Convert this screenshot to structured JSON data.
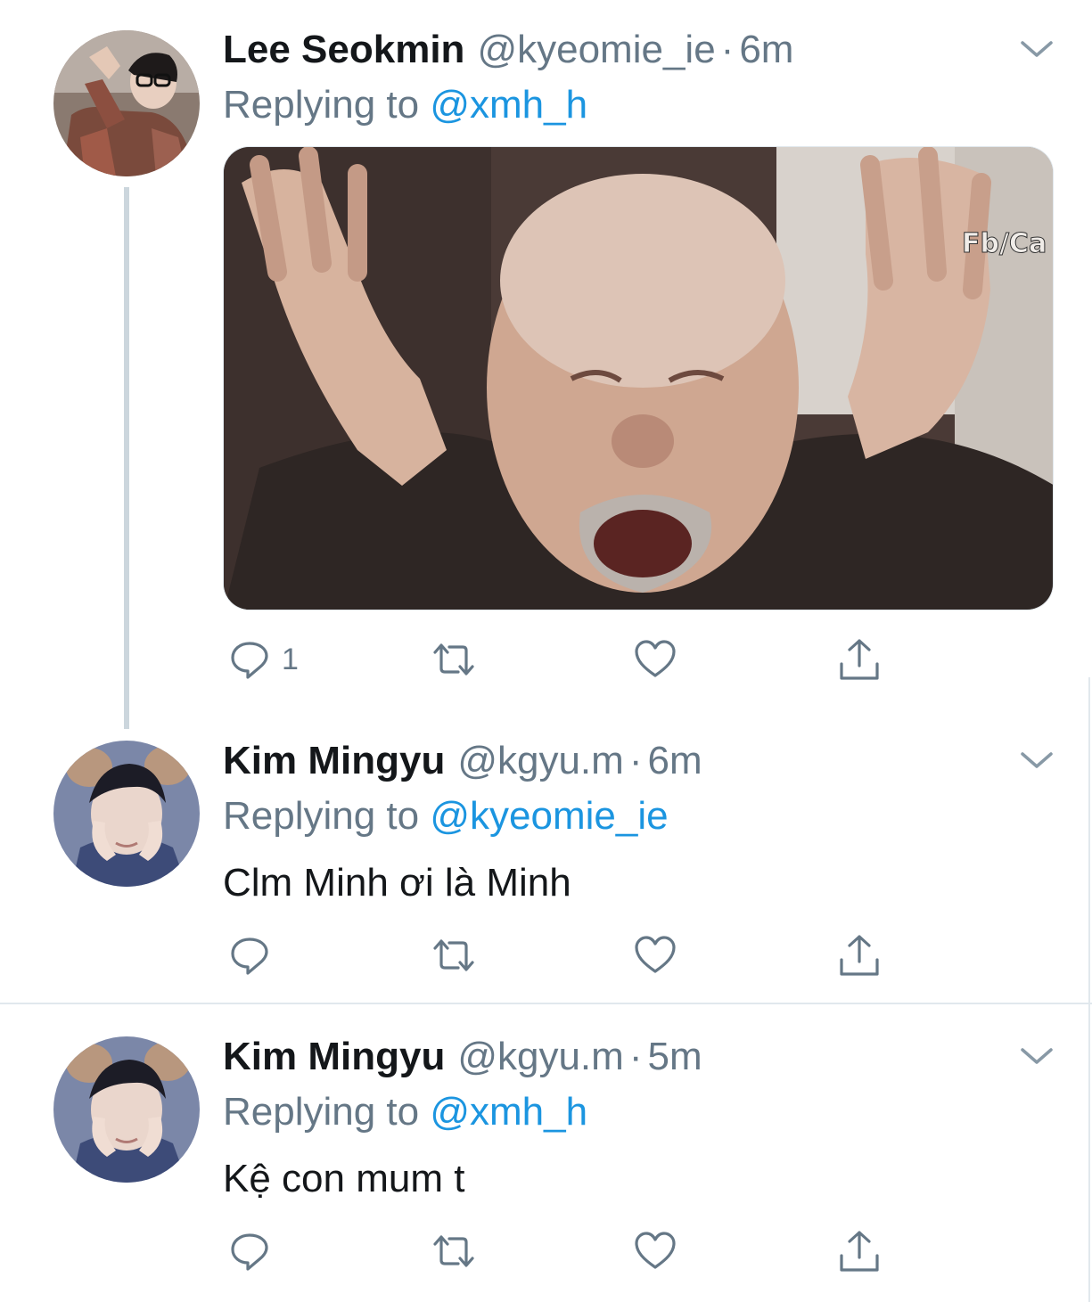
{
  "tweets": [
    {
      "name": "Lee Seokmin",
      "handle": "@kyeomie_ie",
      "dot": "·",
      "time": "6m",
      "replying_prefix": "Replying to ",
      "replying_to": "@xmh_h",
      "media_watermark": "Fb/Ca",
      "reply_count": "1"
    },
    {
      "name": "Kim Mingyu",
      "handle": "@kgyu.m",
      "dot": "·",
      "time": "6m",
      "replying_prefix": "Replying to ",
      "replying_to": "@kyeomie_ie",
      "text": "Clm Minh ơi là Minh"
    },
    {
      "name": "Kim Mingyu",
      "handle": "@kgyu.m",
      "dot": "·",
      "time": "5m",
      "replying_prefix": "Replying to ",
      "replying_to": "@xmh_h",
      "text": "Kệ con mum t"
    }
  ],
  "icons": {
    "reply": "reply-icon",
    "retweet": "retweet-icon",
    "like": "like-icon",
    "share": "share-icon",
    "more": "chevron-down-icon"
  },
  "colors": {
    "mention": "#1b95e0",
    "secondary": "#657786",
    "thread_line": "#ccd6dd"
  }
}
